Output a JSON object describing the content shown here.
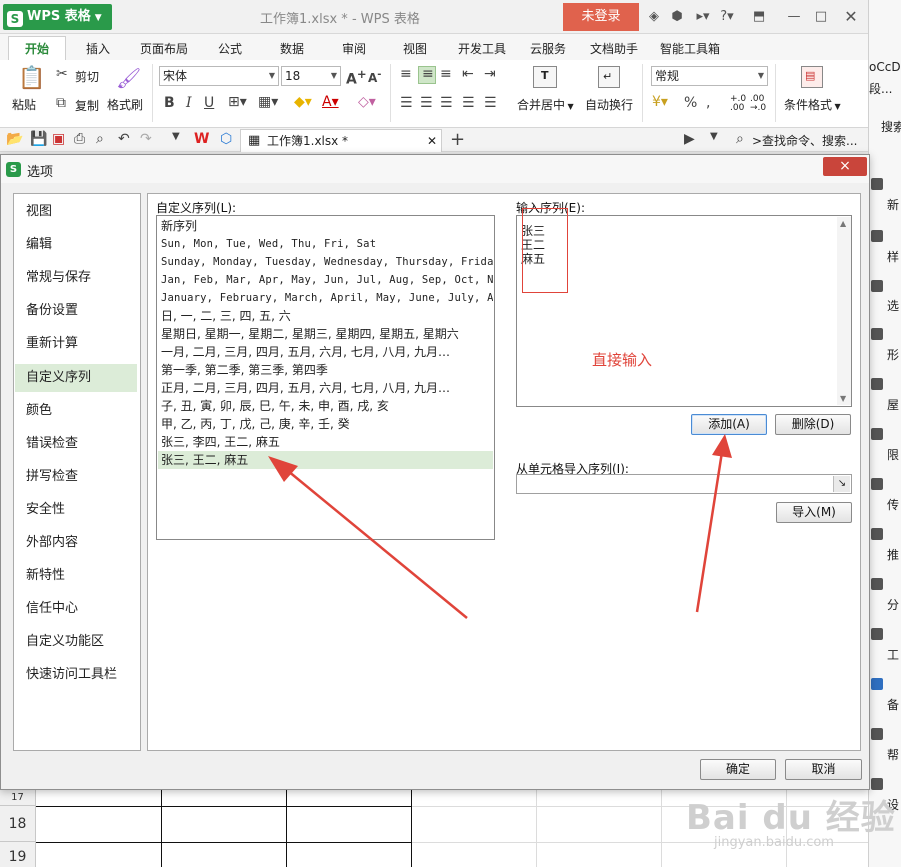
{
  "app": {
    "logo": "WPS 表格",
    "doc_title": "工作簿1.xlsx * - WPS 表格",
    "login": "未登录"
  },
  "menu": [
    "开始",
    "插入",
    "页面布局",
    "公式",
    "数据",
    "审阅",
    "视图",
    "开发工具",
    "云服务",
    "文档助手",
    "智能工具箱"
  ],
  "ribbon": {
    "paste": "粘贴",
    "cut": "剪切",
    "copy": "复制",
    "format_painter": "格式刷",
    "font_name": "宋体",
    "font_size": "18",
    "merge": "合并居中",
    "wrap": "自动换行",
    "number_format": "常规",
    "cond_format": "条件格式"
  },
  "quickbar": {
    "doc_tab": "工作簿1.xlsx *",
    "search": ">查找命令、搜索..."
  },
  "right_panel": {
    "snippets": [
      "oCcDc",
      "段...",
      "搜索",
      "新",
      "样",
      "选",
      "形",
      "屋",
      "限",
      "传",
      "推",
      "分",
      "工",
      "备",
      "帮",
      "设"
    ]
  },
  "sheet": {
    "rows": [
      "17",
      "18",
      "19"
    ]
  },
  "dialog": {
    "title": "选项",
    "close": "×",
    "nav": [
      "视图",
      "编辑",
      "常规与保存",
      "备份设置",
      "重新计算",
      "自定义序列",
      "颜色",
      "错误检查",
      "拼写检查",
      "安全性",
      "外部内容",
      "新特性",
      "信任中心",
      "自定义功能区",
      "快速访问工具栏"
    ],
    "nav_selected_index": 5,
    "custom_list_label": "自定义序列(L):",
    "sequences": [
      "新序列",
      "Sun, Mon, Tue, Wed, Thu, Fri, Sat",
      "Sunday, Monday, Tuesday, Wednesday, Thursday, Friday…",
      "Jan, Feb, Mar, Apr, May, Jun, Jul, Aug, Sep, Oct, No…",
      "January, February, March, April, May, June, July, Au…",
      "日, 一, 二, 三, 四, 五, 六",
      "星期日, 星期一, 星期二, 星期三, 星期四, 星期五, 星期六",
      "一月, 二月, 三月, 四月, 五月, 六月, 七月, 八月, 九月…",
      "第一季, 第二季, 第三季, 第四季",
      "正月, 二月, 三月, 四月, 五月, 六月, 七月, 八月, 九月…",
      "子, 丑, 寅, 卯, 辰, 巳, 午, 未, 申, 酉, 戌, 亥",
      "甲, 乙, 丙, 丁, 戊, 己, 庚, 辛, 壬, 癸",
      "张三, 李四, 王二, 麻五",
      "张三, 王二, 麻五"
    ],
    "sequence_selected_index": 13,
    "input_label": "输入序列(E):",
    "input_lines": [
      "张三",
      "王二",
      "麻五"
    ],
    "add_button": "添加(A)",
    "delete_button": "删除(D)",
    "import_label": "从单元格导入序列(I):",
    "import_button": "导入(M)",
    "ok": "确定",
    "cancel": "取消"
  },
  "annotation": {
    "text": "直接输入",
    "color": "#e0443a"
  },
  "watermark": {
    "main": "Bai du 经验",
    "sub": "jingyan.baidu.com"
  }
}
